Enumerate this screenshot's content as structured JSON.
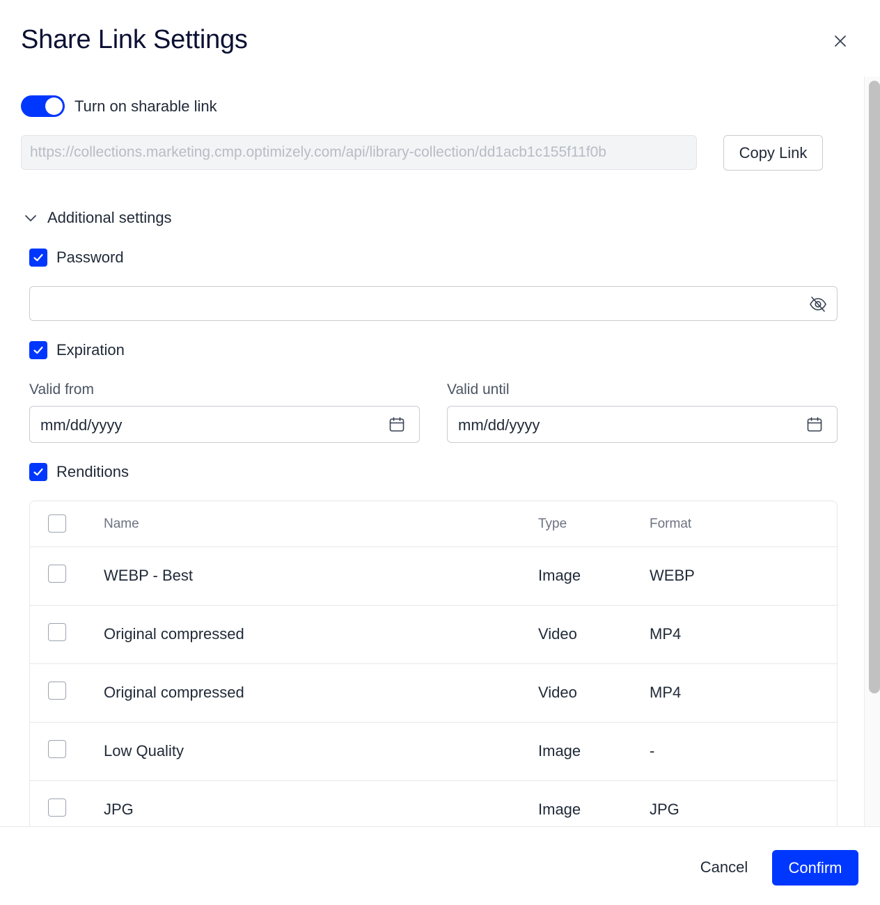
{
  "dialog": {
    "title": "Share Link Settings"
  },
  "share": {
    "toggle_label": "Turn on sharable link",
    "toggle_on": true,
    "url": "https://collections.marketing.cmp.optimizely.com/api/library-collection/dd1acb1c155f11f0b",
    "copy_label": "Copy Link"
  },
  "additional": {
    "label": "Additional settings"
  },
  "password": {
    "label": "Password",
    "value": ""
  },
  "expiration": {
    "label": "Expiration",
    "valid_from_label": "Valid from",
    "valid_from_value": "mm/dd/yyyy",
    "valid_until_label": "Valid until",
    "valid_until_value": "mm/dd/yyyy"
  },
  "renditions": {
    "label": "Renditions",
    "columns": {
      "name": "Name",
      "type": "Type",
      "format": "Format"
    },
    "rows": [
      {
        "name": "WEBP - Best",
        "type": "Image",
        "format": "WEBP"
      },
      {
        "name": "Original compressed",
        "type": "Video",
        "format": "MP4"
      },
      {
        "name": "Original compressed",
        "type": "Video",
        "format": "MP4"
      },
      {
        "name": "Low Quality",
        "type": "Image",
        "format": "-"
      },
      {
        "name": "JPG",
        "type": "Image",
        "format": "JPG"
      }
    ]
  },
  "footer": {
    "cancel_label": "Cancel",
    "confirm_label": "Confirm"
  },
  "colors": {
    "accent": "#0037ff",
    "title": "#0b1033"
  }
}
